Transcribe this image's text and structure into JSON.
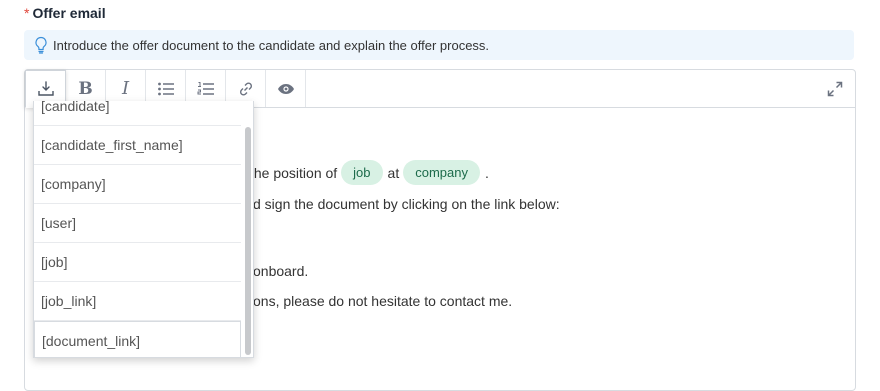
{
  "field": {
    "required_mark": "*",
    "label": "Offer email"
  },
  "hint": {
    "text": "Introduce the offer document to the candidate and explain the offer process.",
    "icon": "lightbulb-icon"
  },
  "toolbar": {
    "buttons": [
      {
        "name": "insert-placeholder",
        "icon": "insert-icon"
      },
      {
        "name": "bold",
        "glyph": "B"
      },
      {
        "name": "italic",
        "glyph": "I"
      },
      {
        "name": "bullet-list",
        "icon": "bullet-list-icon"
      },
      {
        "name": "numbered-list",
        "icon": "numbered-list-icon"
      },
      {
        "name": "link",
        "icon": "link-icon"
      },
      {
        "name": "preview",
        "icon": "eye-icon"
      }
    ],
    "expand_icon": "expand-icon"
  },
  "content": {
    "line1_prefix": "the position of",
    "chip_job": "job",
    "line1_mid": "at",
    "chip_company": "company",
    "line1_suffix": ".",
    "line2": "d sign the document by clicking on the link below:",
    "line3": "onboard.",
    "line4": "ons, please do not hesitate to contact me."
  },
  "dropdown": {
    "items": [
      "[candidate]",
      "[candidate_first_name]",
      "[company]",
      "[user]",
      "[job]",
      "[job_link]",
      "[document_link]"
    ]
  },
  "colors": {
    "chip_bg": "#d8f1e4",
    "chip_text": "#1d6b4b",
    "hint_bg": "#eef6fd",
    "required": "#e0463b"
  }
}
